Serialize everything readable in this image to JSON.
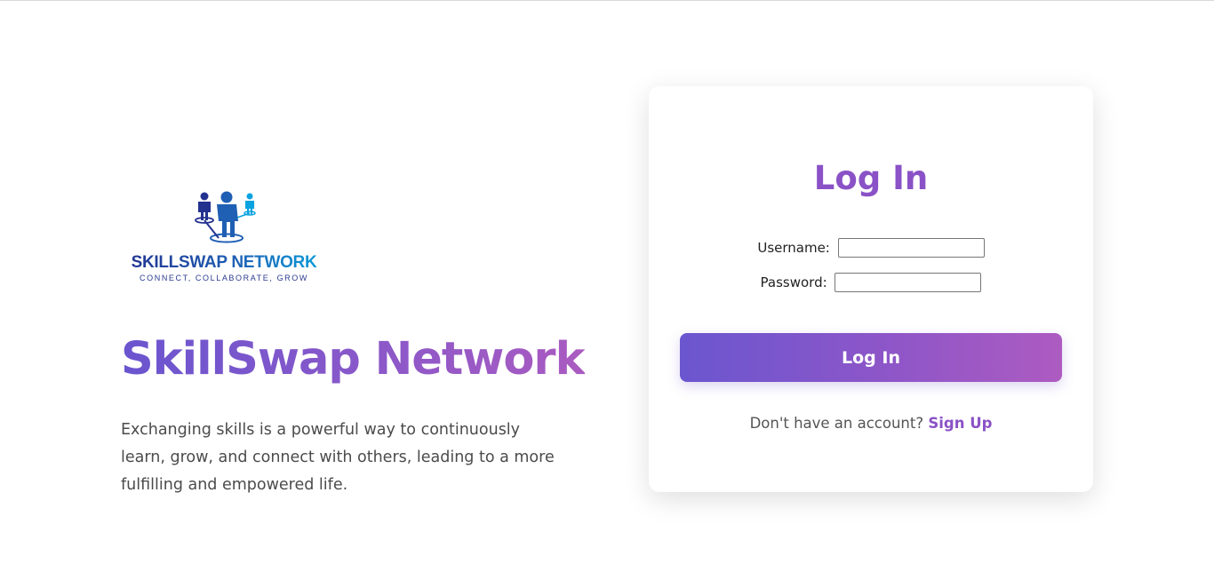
{
  "brand": {
    "logo_title": "SKILLSWAP NETWORK",
    "logo_tagline": "CONNECT, COLLABORATE, GROW",
    "logo_icon": "people-network-icon",
    "colors": {
      "logo_dark": "#23318f",
      "logo_light": "#0aa3df",
      "accent_start": "#6a55cf",
      "accent_end": "#aa5bc0"
    }
  },
  "hero": {
    "title": "SkillSwap Network",
    "description": "Exchanging skills is a powerful way to continuously learn, grow, and connect with others, leading to a more fulfilling and empowered life."
  },
  "login": {
    "title": "Log In",
    "username_label": "Username:",
    "username_value": "",
    "password_label": "Password:",
    "password_value": "",
    "submit_label": "Log In",
    "signup_prompt": "Don't have an account?",
    "signup_link": "Sign Up"
  }
}
